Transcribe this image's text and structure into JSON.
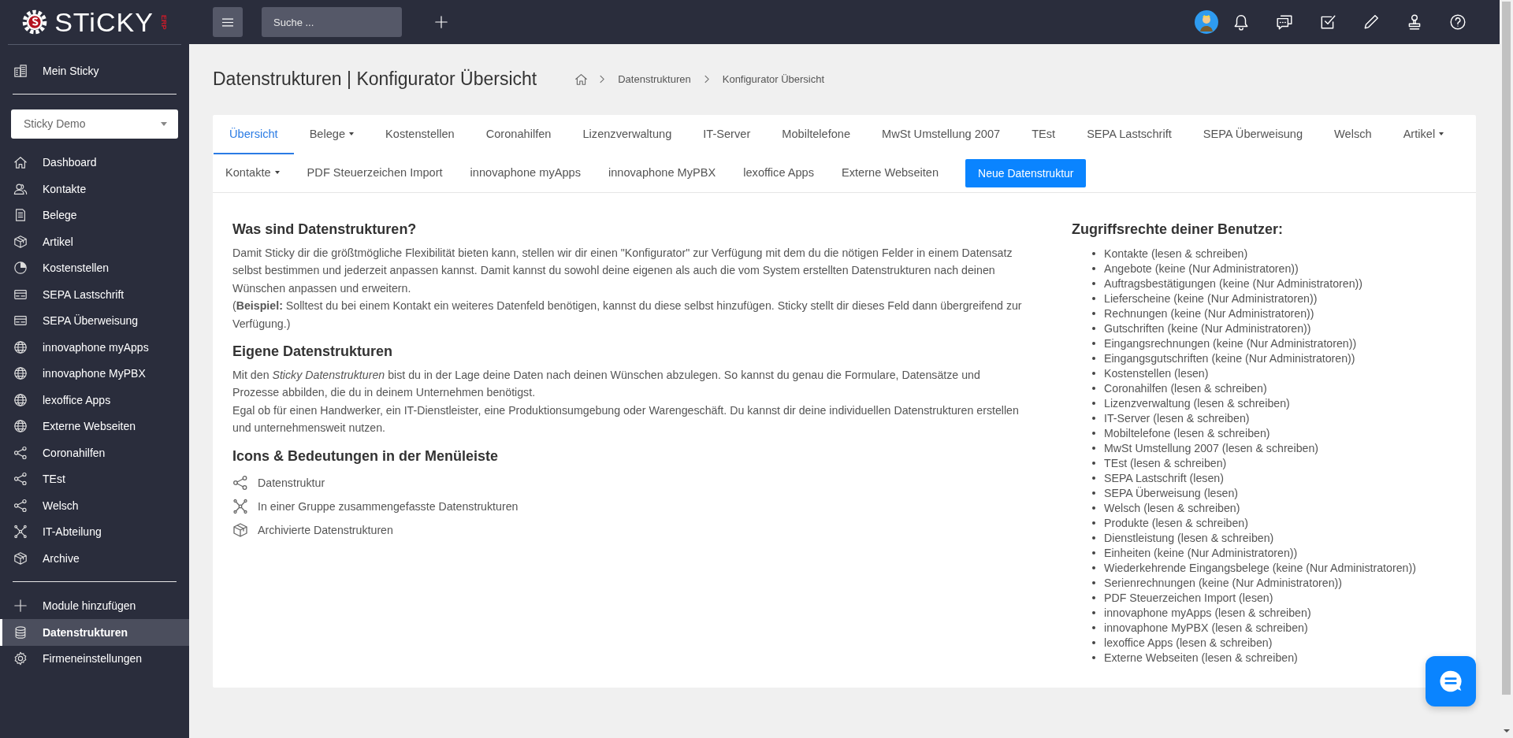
{
  "logo": {
    "text": "STiCKY",
    "suffix": "ERP"
  },
  "sidebar": {
    "top_item": {
      "label": "Mein Sticky",
      "kind": "building"
    },
    "company_select": {
      "value": "Sticky Demo"
    },
    "items": [
      {
        "label": "Dashboard",
        "kind": "home",
        "selected": false
      },
      {
        "label": "Kontakte",
        "kind": "contacts",
        "selected": false
      },
      {
        "label": "Belege",
        "kind": "document",
        "selected": false
      },
      {
        "label": "Artikel",
        "kind": "box",
        "selected": false
      },
      {
        "label": "Kostenstellen",
        "kind": "pie",
        "selected": false
      },
      {
        "label": "SEPA Lastschrift",
        "kind": "card",
        "selected": false
      },
      {
        "label": "SEPA Überweisung",
        "kind": "card",
        "selected": false
      },
      {
        "label": "innovaphone myApps",
        "kind": "globe",
        "selected": false
      },
      {
        "label": "innovaphone MyPBX",
        "kind": "globe",
        "selected": false
      },
      {
        "label": "lexoffice Apps",
        "kind": "globe",
        "selected": false
      },
      {
        "label": "Externe Webseiten",
        "kind": "globe",
        "selected": false
      },
      {
        "label": "Coronahilfen",
        "kind": "share",
        "selected": false
      },
      {
        "label": "TEst",
        "kind": "share",
        "selected": false
      },
      {
        "label": "Welsch",
        "kind": "share",
        "selected": false
      },
      {
        "label": "IT-Abteilung",
        "kind": "network",
        "selected": false
      },
      {
        "label": "Archive",
        "kind": "box",
        "selected": false
      }
    ],
    "bottom_items": [
      {
        "label": "Module hinzufügen",
        "kind": "plus",
        "selected": false
      },
      {
        "label": "Datenstrukturen",
        "kind": "database",
        "selected": true
      },
      {
        "label": "Firmeneinstellungen",
        "kind": "gear",
        "selected": false
      }
    ]
  },
  "topbar": {
    "search": {
      "placeholder": "Suche ..."
    }
  },
  "page_title": "Datenstrukturen | Konfigurator Übersicht",
  "breadcrumb": [
    "Datenstrukturen",
    "Konfigurator Übersicht"
  ],
  "tabs": [
    {
      "label": "Übersicht",
      "dropdown": false,
      "selected": true
    },
    {
      "label": "Belege",
      "dropdown": true,
      "selected": false
    },
    {
      "label": "Kostenstellen",
      "dropdown": false,
      "selected": false
    },
    {
      "label": "Coronahilfen",
      "dropdown": false,
      "selected": false
    },
    {
      "label": "Lizenzverwaltung",
      "dropdown": false,
      "selected": false
    },
    {
      "label": "IT-Server",
      "dropdown": false,
      "selected": false
    },
    {
      "label": "Mobiltelefone",
      "dropdown": false,
      "selected": false
    },
    {
      "label": "MwSt Umstellung 2007",
      "dropdown": false,
      "selected": false
    },
    {
      "label": "TEst",
      "dropdown": false,
      "selected": false
    },
    {
      "label": "SEPA Lastschrift",
      "dropdown": false,
      "selected": false
    },
    {
      "label": "SEPA Überweisung",
      "dropdown": false,
      "selected": false
    },
    {
      "label": "Welsch",
      "dropdown": false,
      "selected": false
    },
    {
      "label": "Artikel",
      "dropdown": true,
      "selected": false
    },
    {
      "label": "Kontakte",
      "dropdown": true,
      "selected": false
    },
    {
      "label": "PDF Steuerzeichen Import",
      "dropdown": false,
      "selected": false
    },
    {
      "label": "innovaphone myApps",
      "dropdown": false,
      "selected": false
    },
    {
      "label": "innovaphone MyPBX",
      "dropdown": false,
      "selected": false
    },
    {
      "label": "lexoffice Apps",
      "dropdown": false,
      "selected": false
    },
    {
      "label": "Externe Webseiten",
      "dropdown": false,
      "selected": false
    }
  ],
  "new_button": "Neue Datenstruktur",
  "sections": [
    {
      "heading": "Was sind Datenstrukturen?",
      "paragraphs": [
        "Damit Sticky dir die größtmögliche Flexibilität bieten kann, stellen wir dir einen \"Konfigurator\" zur Verfügung mit dem du die nötigen Felder in einem Datensatz selbst bestimmen und jederzeit anpassen kannst. Damit kannst du sowohl deine eigenen als auch die vom System erstellten Datenstrukturen nach deinen Wünschen anpassen und erweitern.",
        "(**Beispiel:** Solltest du bei einem Kontakt ein weiteres Datenfeld benötigen, kannst du diese selbst hinzufügen. Sticky stellt dir dieses Feld dann übergreifend zur Verfügung.)"
      ]
    },
    {
      "heading": "Eigene Datenstrukturen",
      "paragraphs": [
        "Mit den *Sticky Datenstrukturen* bist du in der Lage deine Daten nach deinen Wünschen abzulegen. So kannst du genau die Formulare, Datensätze und Prozesse abbilden, die du in deinem Unternehmen benötigst.",
        "Egal ob für einen Handwerker, ein IT-Dienstleister, eine Produktionsumgebung oder Warengeschäft. Du kannst dir deine individuellen Datenstrukturen erstellen und unternehmensweit nutzen."
      ]
    }
  ],
  "legend": {
    "heading": "Icons & Bedeutungen in der Menüleiste",
    "items": [
      {
        "kind": "share",
        "label": "Datenstruktur"
      },
      {
        "kind": "network",
        "label": "In einer Gruppe zusammengefasste Datenstrukturen"
      },
      {
        "kind": "box",
        "label": "Archivierte Datenstrukturen"
      }
    ]
  },
  "permissions": {
    "heading": "Zugriffsrechte deiner Benutzer:",
    "items": [
      "Kontakte (lesen & schreiben)",
      "Angebote (keine (Nur Administratoren))",
      "Auftragsbestätigungen (keine (Nur Administratoren))",
      "Lieferscheine (keine (Nur Administratoren))",
      "Rechnungen (keine (Nur Administratoren))",
      "Gutschriften (keine (Nur Administratoren))",
      "Eingangsrechnungen (keine (Nur Administratoren))",
      "Eingangsgutschriften (keine (Nur Administratoren))",
      "Kostenstellen (lesen)",
      "Coronahilfen (lesen & schreiben)",
      "Lizenzverwaltung (lesen & schreiben)",
      "IT-Server (lesen & schreiben)",
      "Mobiltelefone (lesen & schreiben)",
      "MwSt Umstellung 2007 (lesen & schreiben)",
      "TEst (lesen & schreiben)",
      "SEPA Lastschrift (lesen)",
      "SEPA Überweisung (lesen)",
      "Welsch (lesen & schreiben)",
      "Produkte (lesen & schreiben)",
      "Dienstleistung (lesen & schreiben)",
      "Einheiten (keine (Nur Administratoren))",
      "Wiederkehrende Eingangsbelege (keine (Nur Administratoren))",
      "Serienrechnungen (keine (Nur Administratoren))",
      "PDF Steuerzeichen Import (lesen)",
      "innovaphone myApps (lesen & schreiben)",
      "innovaphone MyPBX (lesen & schreiben)",
      "lexoffice Apps (lesen & schreiben)",
      "Externe Webseiten (lesen & schreiben)"
    ]
  }
}
